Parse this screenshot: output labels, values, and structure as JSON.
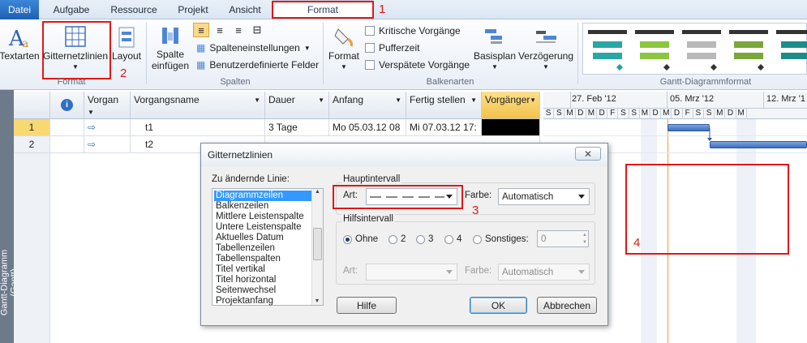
{
  "tabs": {
    "file": "Datei",
    "items": [
      "Aufgabe",
      "Ressource",
      "Projekt",
      "Ansicht"
    ],
    "format": "Format"
  },
  "annotations": {
    "n1": "1",
    "n2": "2",
    "n3": "3",
    "n4": "4"
  },
  "ribbon": {
    "textarten": "Textarten",
    "gitternetzlinien": "Gitternetzlinien",
    "layout": "Layout",
    "format_group": "Format",
    "spalte_einfuegen_1": "Spalte",
    "spalte_einfuegen_2": "einfügen",
    "spalteneinstellungen": "Spalteneinstellungen",
    "benutzerdefinierte_felder": "Benutzerdefinierte Felder",
    "spalten_group": "Spalten",
    "format_btn": "Format",
    "kritische": "Kritische Vorgänge",
    "pufferzeit": "Pufferzeit",
    "verspaetete": "Verspätete Vorgänge",
    "basisplan": "Basisplan",
    "verzoegerung": "Verzögerung",
    "balkenarten_group": "Balkenarten",
    "gantt_group": "Gantt-Diagrammformat"
  },
  "table": {
    "headers": {
      "vorgan": "Vorgan",
      "vorgangsname": "Vorgangsname",
      "dauer": "Dauer",
      "anfang": "Anfang",
      "fertig": "Fertig stellen",
      "vorgaenger": "Vorgänger"
    },
    "rows": [
      {
        "num": "1",
        "name": "t1",
        "dauer": "3 Tage",
        "anfang": "Mo 05.03.12 08",
        "fertig": "Mi 07.03.12 17:"
      },
      {
        "num": "2",
        "name": "t2",
        "dauer": "",
        "anfang": "",
        "fertig": ""
      }
    ]
  },
  "sidebar_label": "Gantt-Diagramm (Gantt)",
  "timeline": {
    "weeks": [
      "27. Feb '12",
      "05. Mrz '12",
      "12. Mrz '1"
    ],
    "days": [
      "S",
      "S",
      "M",
      "D",
      "M",
      "D",
      "F",
      "S",
      "S",
      "M",
      "D",
      "M",
      "D",
      "F",
      "S",
      "S",
      "M",
      "D",
      "M"
    ]
  },
  "dialog": {
    "title": "Gitternetzlinien",
    "close": "✕",
    "list_label": "Zu ändernde Linie:",
    "list_items": [
      "Diagrammzeilen",
      "Balkenzeilen",
      "Mittlere Leistenspalte",
      "Untere Leistenspalte",
      "Aktuelles Datum",
      "Tabellenzeilen",
      "Tabellenspalten",
      "Titel vertikal",
      "Titel horizontal",
      "Seitenwechsel",
      "Projektanfang"
    ],
    "haupt_label": "Hauptintervall",
    "art_label": "Art:",
    "farbe_label": "Farbe:",
    "haupt_farbe": "Automatisch",
    "hilfs_label": "Hilfsintervall",
    "radio_ohne": "Ohne",
    "radio_2": "2",
    "radio_3": "3",
    "radio_4": "4",
    "radio_sonstiges": "Sonstiges:",
    "sonstiges_value": "0",
    "hilfs_art_label": "Art:",
    "hilfs_farbe_label": "Farbe:",
    "hilfs_farbe": "Automatisch",
    "btn_hilfe": "Hilfe",
    "btn_ok": "OK",
    "btn_abbrechen": "Abbrechen"
  },
  "colors": {
    "accent": "#1f5fb2",
    "annotation": "#e01818",
    "vorgaenger_header": "#f7c84a"
  }
}
